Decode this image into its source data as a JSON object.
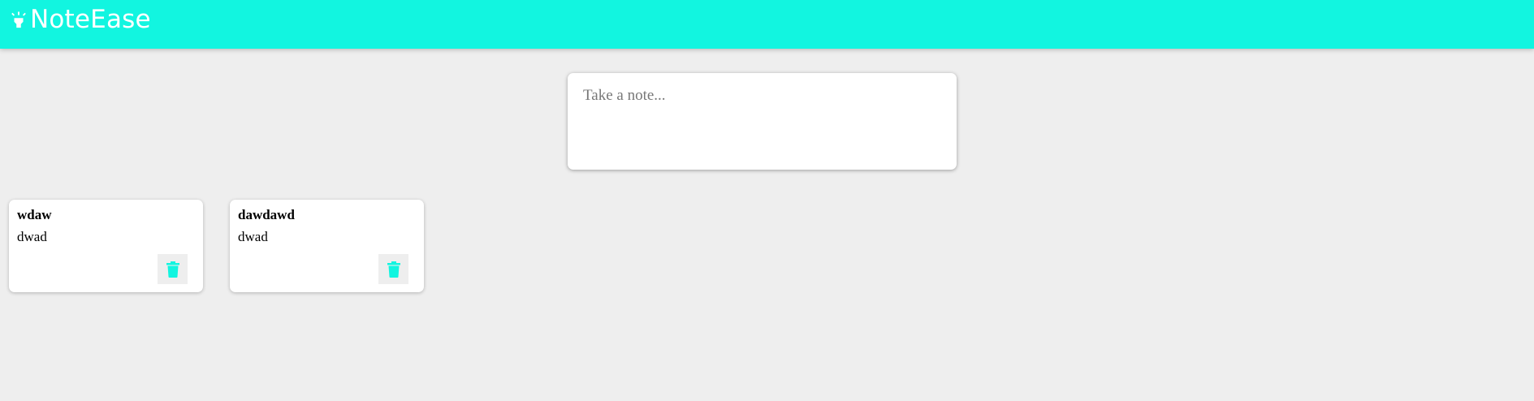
{
  "app": {
    "brand_name": "NoteEase",
    "accent_color": "#12f5e0",
    "brand_icon": "highlight-icon"
  },
  "composer": {
    "placeholder": "Take a note..."
  },
  "notes": [
    {
      "title": "wdaw",
      "content": "dwad",
      "delete_icon": "trash-icon"
    },
    {
      "title": "dawdawd",
      "content": "dwad",
      "delete_icon": "trash-icon"
    }
  ]
}
